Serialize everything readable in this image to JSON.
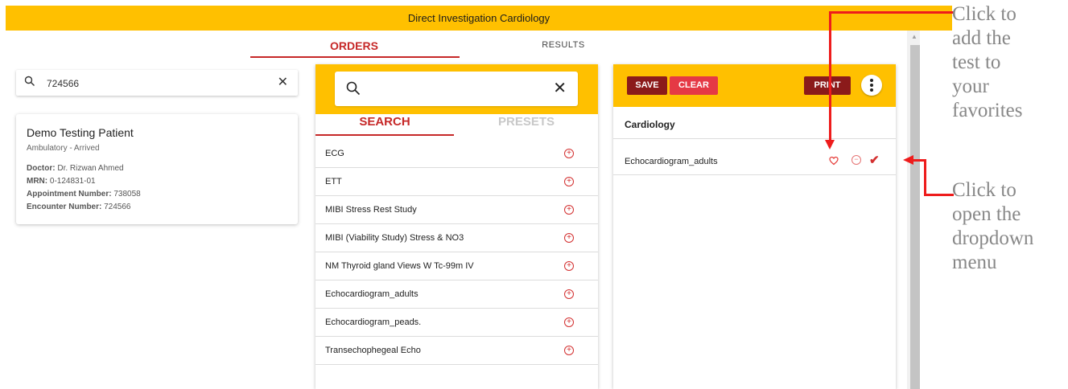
{
  "app": {
    "title": "Direct Investigation Cardiology"
  },
  "tabs": {
    "orders": "ORDERS",
    "results": "RESULTS"
  },
  "patient_search": {
    "value": "724566"
  },
  "patient": {
    "name": "Demo Testing Patient",
    "status": "Ambulatory - Arrived",
    "doctor_label": "Doctor:",
    "doctor": "Dr. Rizwan Ahmed",
    "mrn_label": "MRN:",
    "mrn": "0-124831-01",
    "appointment_label": "Appointment Number:",
    "appointment": "738058",
    "encounter_label": "Encounter Number:",
    "encounter": "724566"
  },
  "test_search": {
    "value": ""
  },
  "subtabs": {
    "search": "SEARCH",
    "presets": "PRESETS"
  },
  "tests": [
    "ECG",
    "ETT",
    "MIBI Stress Rest Study",
    "MIBI (Viability Study) Stress & NO3",
    "NM Thyroid gland Views W Tc-99m IV",
    "Echocardiogram_adults",
    "Echocardiogram_peads.",
    "Transechophegeal Echo"
  ],
  "order": {
    "save": "SAVE",
    "clear": "CLEAR",
    "print": "PRINT",
    "category": "Cardiology",
    "selected": "Echocardiogram_adults"
  },
  "annotations": {
    "favorite": [
      "Click to",
      "add the",
      "test to",
      "your",
      "favorites"
    ],
    "dropdown": [
      "Click to",
      "open the",
      "dropdown",
      "menu"
    ]
  },
  "colors": {
    "header": "#ffc000",
    "accent": "#c62828",
    "annotation_arrow": "#ee1c1c"
  }
}
